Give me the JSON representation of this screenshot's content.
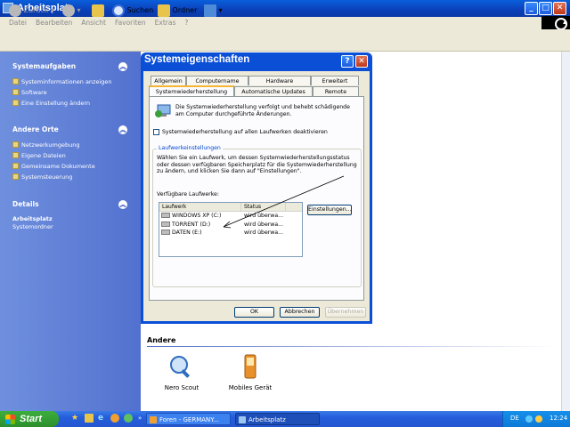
{
  "window": {
    "title": "Arbeitsplatz",
    "min": "_",
    "max": "□",
    "close": "✕"
  },
  "menu": [
    "Datei",
    "Bearbeiten",
    "Ansicht",
    "Favoriten",
    "Extras",
    "?"
  ],
  "toolbar": {
    "back": "Zurück",
    "search": "Suchen",
    "folders": "Ordner"
  },
  "sidebar": {
    "tasks_title": "Systemaufgaben",
    "tasks": [
      "Systeminformationen anzeigen",
      "Software",
      "Eine Einstellung ändern"
    ],
    "places_title": "Andere Orte",
    "places": [
      "Netzwerkumgebung",
      "Eigene Dateien",
      "Gemeinsame Dokumente",
      "Systemsteuerung"
    ],
    "details_title": "Details",
    "details_name": "Arbeitsplatz",
    "details_type": "Systemordner"
  },
  "dialog": {
    "title": "Systemeigenschaften",
    "help": "?",
    "close": "✕",
    "tabs_back": [
      "Allgemein",
      "Computername",
      "Hardware",
      "Erweitert"
    ],
    "tabs_front": [
      "Systemwiederherstellung",
      "Automatische Updates",
      "Remote"
    ],
    "intro": "Die Systemwiederherstellung verfolgt und behebt schädigende am Computer durchgeführte Änderungen.",
    "checkbox_label": "Systemwiederherstellung auf allen Laufwerken deaktivieren",
    "group_label": "Laufwerkeinstellungen",
    "group_text": "Wählen Sie ein Laufwerk, um dessen Systemwiederherstellungsstatus oder dessen verfügbaren Speicherplatz für die Systemwiederherstellung zu ändern, und klicken Sie dann auf \"Einstellungen\".",
    "drives_label": "Verfügbare Laufwerke:",
    "columns": [
      "Laufwerk",
      "Status"
    ],
    "drives": [
      {
        "name": "WINDOWS XP (C:)",
        "status": "wird überwa..."
      },
      {
        "name": "TORRENT (D:)",
        "status": "wird überwa..."
      },
      {
        "name": "DATEN (E:)",
        "status": "wird überwa..."
      }
    ],
    "settings_button": "Einstellungen...",
    "ok": "OK",
    "cancel": "Abbrechen",
    "apply": "Übernehmen"
  },
  "other": {
    "title": "Andere",
    "items": [
      "Nero Scout",
      "Mobiles Gerät"
    ]
  },
  "taskbar": {
    "start": "Start",
    "tasks": [
      "Foren - GERMANY...",
      "Arbeitsplatz"
    ],
    "lang": "DE",
    "clock": "12:24"
  },
  "colors": {
    "xp_blue": "#0a4fd6",
    "start_green": "#2c902c",
    "face": "#ece9d8"
  }
}
